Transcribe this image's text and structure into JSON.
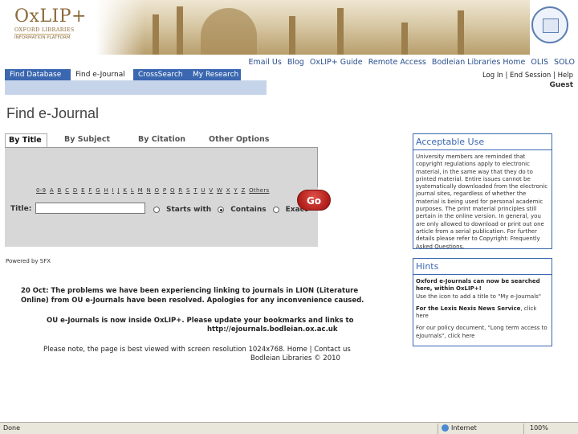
{
  "header": {
    "logo_title": "OxLIP+",
    "logo_line1": "OXFORD LIBRARIES",
    "logo_line2": "INFORMATION PLATFORM"
  },
  "top_links": [
    "Email Us",
    "Blog",
    "OxLIP+ Guide",
    "Remote Access",
    "Bodleian Libraries Home",
    "OLIS",
    "SOLO"
  ],
  "nav": {
    "items": [
      "Find Database",
      "Find e-Journal",
      "CrossSearch",
      "My Research"
    ],
    "active_index": 1
  },
  "user_links": [
    "Log In",
    "End Session",
    "Help"
  ],
  "user_name": "Guest",
  "page_title": "Find e-Journal",
  "tabs": [
    "By Title",
    "By Subject",
    "By Citation",
    "Other Options"
  ],
  "alphabet": [
    "0-9",
    "A",
    "B",
    "C",
    "D",
    "E",
    "F",
    "G",
    "H",
    "I",
    "J",
    "K",
    "L",
    "M",
    "N",
    "O",
    "P",
    "Q",
    "R",
    "S",
    "T",
    "U",
    "V",
    "W",
    "X",
    "Y",
    "Z",
    "Others"
  ],
  "search": {
    "title_label": "Title:",
    "title_value": "",
    "options": [
      "Starts with",
      "Contains",
      "Exact"
    ],
    "selected_option": "Contains",
    "go_label": "Go"
  },
  "powered_by": "Powered by SFX",
  "notices": {
    "line1": "20 Oct: The problems we have been experiencing linking to journals in LION (Literature",
    "line2": "Online) from OU e-Journals have been resolved. Apologies for any inconvenience caused.",
    "line3": "OU e-Journals is now inside OxLIP+. Please update your bookmarks and links to",
    "line4": "http://ejournals.bodleian.ox.ac.uk",
    "line5": "Please note, the page is best viewed with screen resolution 1024x768.",
    "home_link": "Home",
    "contact_link": "Contact us",
    "copyright": "Bodleian Libraries © 2010"
  },
  "acceptable_use": {
    "title": "Acceptable Use",
    "body": "University members are reminded that copyright regulations apply to electronic material, in the same way that they do to printed material. Entire issues cannot be systematically downloaded from the electronic journal sites, regardless of whether the material is being used for personal academic purposes. The print material principles still pertain in the online version. In general, you are only allowed to download or print out one article from a serial publication. For further details please refer to Copyright: Frequently Asked Questions."
  },
  "hints": {
    "title": "Hints",
    "line1": "Oxford e-Journals can now be searched here, within OxLIP+!",
    "line2": "Use the icon to add a title to \"My e-Journals\"",
    "line3_bold": "For the Lexis Nexis News Service",
    "line3_rest": ", click here",
    "line4": "For our policy document, \"Long term access to eJournals\", click here"
  },
  "status_bar": {
    "left": "Done",
    "zone": "Internet",
    "zoom": "100%"
  },
  "colors": {
    "nav_blue": "#3a67b0",
    "subnav": "#c6d4ea",
    "go_red": "#b3201c",
    "logo_gold": "#8a6a3a"
  }
}
